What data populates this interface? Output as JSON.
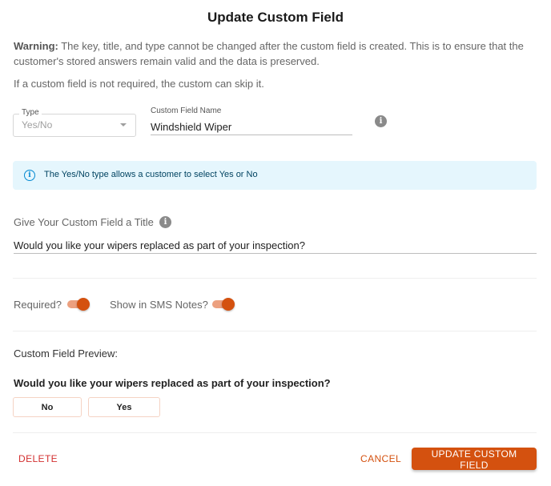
{
  "dialog": {
    "title": "Update Custom Field",
    "warning_label": "Warning:",
    "warning_text": " The key, title, and type cannot be changed after the custom field is created. This is to ensure that the customer's stored answers remain valid and the data is preserved.",
    "skip_note": "If a custom field is not required, the custom can skip it."
  },
  "type_field": {
    "label": "Type",
    "value": "Yes/No",
    "icon": "chevron-down-icon"
  },
  "name_field": {
    "label": "Custom Field Name",
    "value": "Windshield Wiper",
    "info_icon": "info-icon"
  },
  "alert": {
    "icon": "info-outline-icon",
    "text": "The Yes/No type allows a customer to select Yes or No",
    "color": "#0288d1"
  },
  "title_field": {
    "label": "Give Your Custom Field a Title",
    "value": "Would you like your wipers replaced as part of your inspection?",
    "info_icon": "info-icon"
  },
  "toggles": {
    "required": {
      "label": "Required?",
      "on": true
    },
    "sms_notes": {
      "label": "Show in SMS Notes?",
      "on": true
    }
  },
  "preview": {
    "label": "Custom Field Preview:",
    "question": "Would you like your wipers replaced as part of your inspection?",
    "options": [
      "No",
      "Yes"
    ]
  },
  "actions": {
    "delete_label": "DELETE",
    "cancel_label": "CANCEL",
    "update_label": "UPDATE CUSTOM FIELD"
  },
  "colors": {
    "accent": "#d4510f",
    "danger": "#d32f2f",
    "info_bg": "#e5f6fd"
  }
}
